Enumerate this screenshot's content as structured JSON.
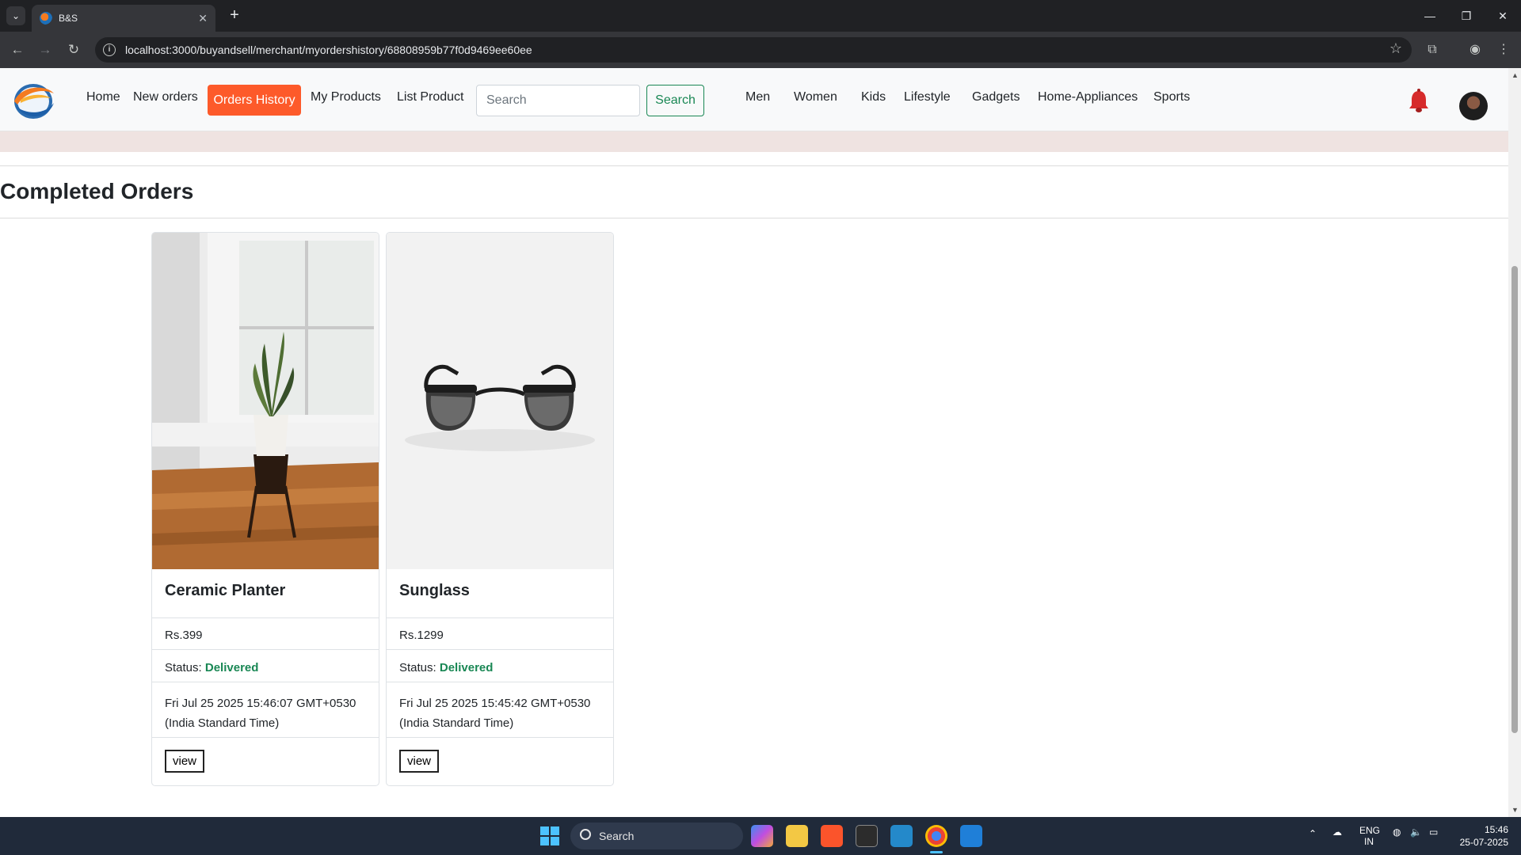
{
  "browser": {
    "tab_title": "B&S",
    "url": "localhost:3000/buyandsell/merchant/myordershistory/68808959b77f0d9469ee60ee"
  },
  "navbar": {
    "links": [
      "Home",
      "New orders",
      "Orders History",
      "My Products",
      "List Product"
    ],
    "active": "Orders History",
    "search_placeholder": "Search",
    "search_button": "Search",
    "categories": [
      "Men",
      "Women",
      "Kids",
      "Lifestyle",
      "Gadgets",
      "Home-Appliances",
      "Sports"
    ]
  },
  "page": {
    "heading": "Completed Orders"
  },
  "orders": [
    {
      "name": "Ceramic Planter",
      "price": "Rs.399",
      "status_label": "Status:",
      "status": "Delivered",
      "date": "Fri Jul 25 2025 15:46:07 GMT+0530 (India Standard Time)",
      "button": "view"
    },
    {
      "name": "Sunglass",
      "price": "Rs.1299",
      "status_label": "Status:",
      "status": "Delivered",
      "date": "Fri Jul 25 2025 15:45:42 GMT+0530 (India Standard Time)",
      "button": "view"
    }
  ],
  "taskbar": {
    "search": "Search",
    "lang_top": "ENG",
    "lang_bottom": "IN",
    "time": "15:46",
    "date": "25-07-2025"
  },
  "colors": {
    "accent": "#fd5a2a",
    "success": "#198754"
  }
}
